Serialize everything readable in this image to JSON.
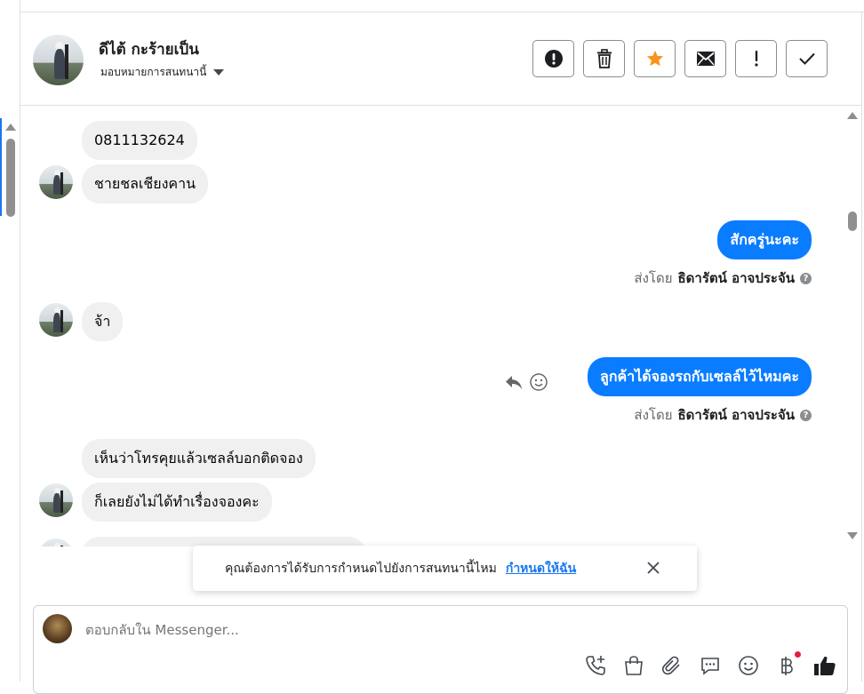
{
  "header": {
    "contact_name": "ดีไต้ กะร้ายเป็น",
    "assign_label": "มอบหมายการสนทนานี้",
    "actions": [
      {
        "name": "spam-button",
        "icon": "exclamation-circle-icon"
      },
      {
        "name": "delete-button",
        "icon": "trash-icon"
      },
      {
        "name": "star-button",
        "icon": "star-icon"
      },
      {
        "name": "mark-unread-button",
        "icon": "envelope-icon"
      },
      {
        "name": "follow-up-button",
        "icon": "exclamation-icon"
      },
      {
        "name": "done-button",
        "icon": "checkmark-icon"
      }
    ]
  },
  "messages": {
    "m1": "0811132624",
    "m2": "ชายชลเชียงคาน",
    "m3": "สักครู่นะคะ",
    "sent_prefix": "ส่งโดย",
    "sender": "ธิดารัตน์ อาจประจัน",
    "m4": "จ้า",
    "m5": "ลูกค้าได้จองรถกับเซลล์ไว้ไหมคะ",
    "m6": "เห็นว่าโทรคุยแล้วเซลล์บอกติดจอง",
    "m7": "ก็เลยยังไม่ได้ทำเรื่องจองคะ"
  },
  "toast": {
    "text": "คุณต้องการได้รับการกำหนดไปยังการสนทนานี้ไหม",
    "link": "กำหนดให้ฉัน"
  },
  "composer": {
    "placeholder": "ตอบกลับใน Messenger...",
    "icons": [
      "phone-add-icon",
      "shopping-bag-icon",
      "paperclip-icon",
      "saved-reply-icon",
      "emoji-icon",
      "baht-payment-icon",
      "thumbs-up-icon"
    ]
  },
  "colors": {
    "outgoing": "#0a7cff",
    "incoming": "#f0f0f0",
    "star": "#f7931e",
    "link": "#1877f2",
    "badge": "#e41e3f"
  }
}
